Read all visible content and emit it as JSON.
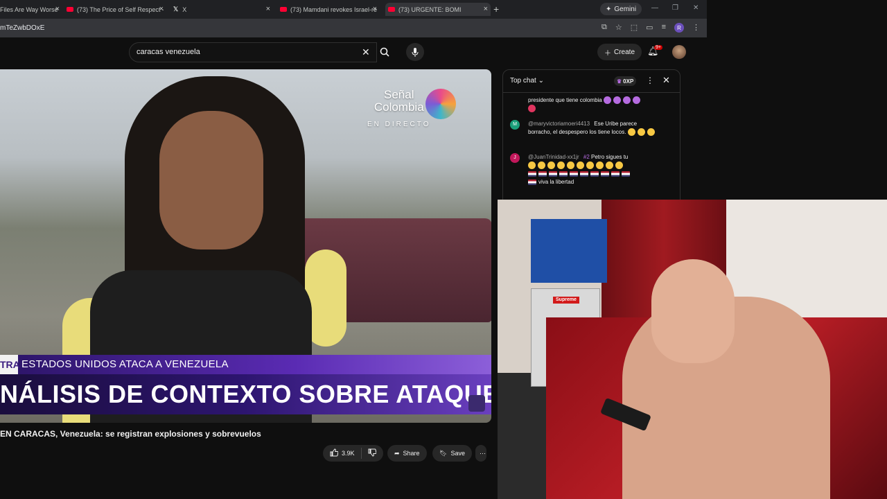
{
  "browser": {
    "tabs": [
      {
        "label": "Files Are Way Worse"
      },
      {
        "label": "(73) The Price of Self Respect -"
      },
      {
        "label": "X"
      },
      {
        "label": "(73) Mamdani revokes Israel-re"
      },
      {
        "label": "(73) URGENTE: BOMI"
      }
    ],
    "new_tab": "+",
    "gemini_label": "Gemini",
    "url_fragment": "mTeZwbDOxE",
    "profile_initial": "R"
  },
  "youtube": {
    "search_query": "caracas venezuela",
    "create_label": "Create",
    "notif_badge": "9+"
  },
  "video": {
    "logo_line1": "Señal",
    "logo_line2": "Colombia",
    "logo_live": "EN DIRECTO",
    "lower_tag": "TRA",
    "lower_third_1": "ESTADOS UNIDOS ATACA A VENEZUELA",
    "lower_third_2": "NÁLISIS DE CONTEXTO SOBRE ATAQUE",
    "title": "EN CARACAS, Venezuela: se registran explosiones y sobrevuelos",
    "likes": "3.9K",
    "share_label": "Share",
    "save_label": "Save"
  },
  "chat": {
    "mode_label": "Top chat",
    "xp_label": "0XP",
    "messages": [
      {
        "avatar": "",
        "author": "",
        "text": "presidente que tiene colombia",
        "emojis": [
          "p",
          "p",
          "p",
          "p"
        ]
      },
      {
        "avatar": "M",
        "avatar_color": "#1a9e7a",
        "author": "@maryvictoriamoeri4413",
        "text": "Ese Uribe parece borracho, el despespero los tiene locos.",
        "emojis": [
          "y",
          "y",
          "y"
        ]
      },
      {
        "avatar": "J",
        "avatar_color": "#c2185b",
        "author": "@JuanTrinidad-xx1jr",
        "rank": "#2",
        "text": "Petro sigues tu",
        "emojis": [
          "y",
          "y",
          "y",
          "y",
          "y",
          "y",
          "y",
          "y",
          "y",
          "y"
        ]
      }
    ],
    "trailing_text": "viva la libertad"
  }
}
